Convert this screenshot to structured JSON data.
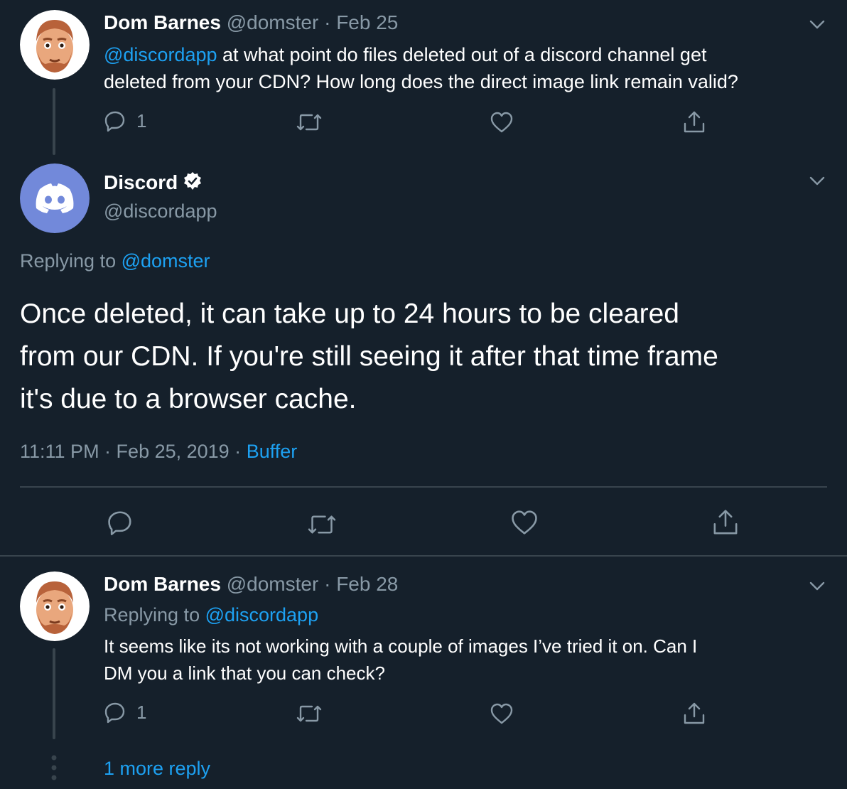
{
  "tweet1": {
    "name": "Dom Barnes",
    "handle": "@domster",
    "sep": "·",
    "date": "Feb 25",
    "mention": "@discordapp",
    "text_line1": " at what point do files deleted out of a discord channel get",
    "text_line2": "deleted from your CDN? How long does the direct image link remain valid?",
    "reply_count": "1"
  },
  "main": {
    "name": "Discord",
    "handle": "@discordapp",
    "replying_prefix": "Replying to ",
    "replying_to": "@domster",
    "line1": "Once deleted, it can take up to 24 hours to be cleared",
    "line2": "from our CDN. If you're still seeing it after that time frame",
    "line3": "it's due to a browser cache.",
    "time": "11:11 PM · Feb 25, 2019 · ",
    "source": "Buffer"
  },
  "tweet3": {
    "name": "Dom Barnes",
    "handle": "@domster",
    "sep": "·",
    "date": "Feb 28",
    "replying_prefix": "Replying to ",
    "replying_to": "@discordapp",
    "text_line1": "It seems like its not working with a couple of images I’ve tried it on. Can I",
    "text_line2": "DM you a link that you can check?",
    "reply_count": "1"
  },
  "more_replies": "1 more reply",
  "colors": {
    "background": "#15202b",
    "accent": "#1da1f2",
    "muted": "#8899a6",
    "divider": "#38444d",
    "discord": "#7289da"
  },
  "icons": [
    "reply-icon",
    "retweet-icon",
    "like-icon",
    "share-icon",
    "chevron-down-icon",
    "verified-badge-icon",
    "discord-logo-icon"
  ]
}
